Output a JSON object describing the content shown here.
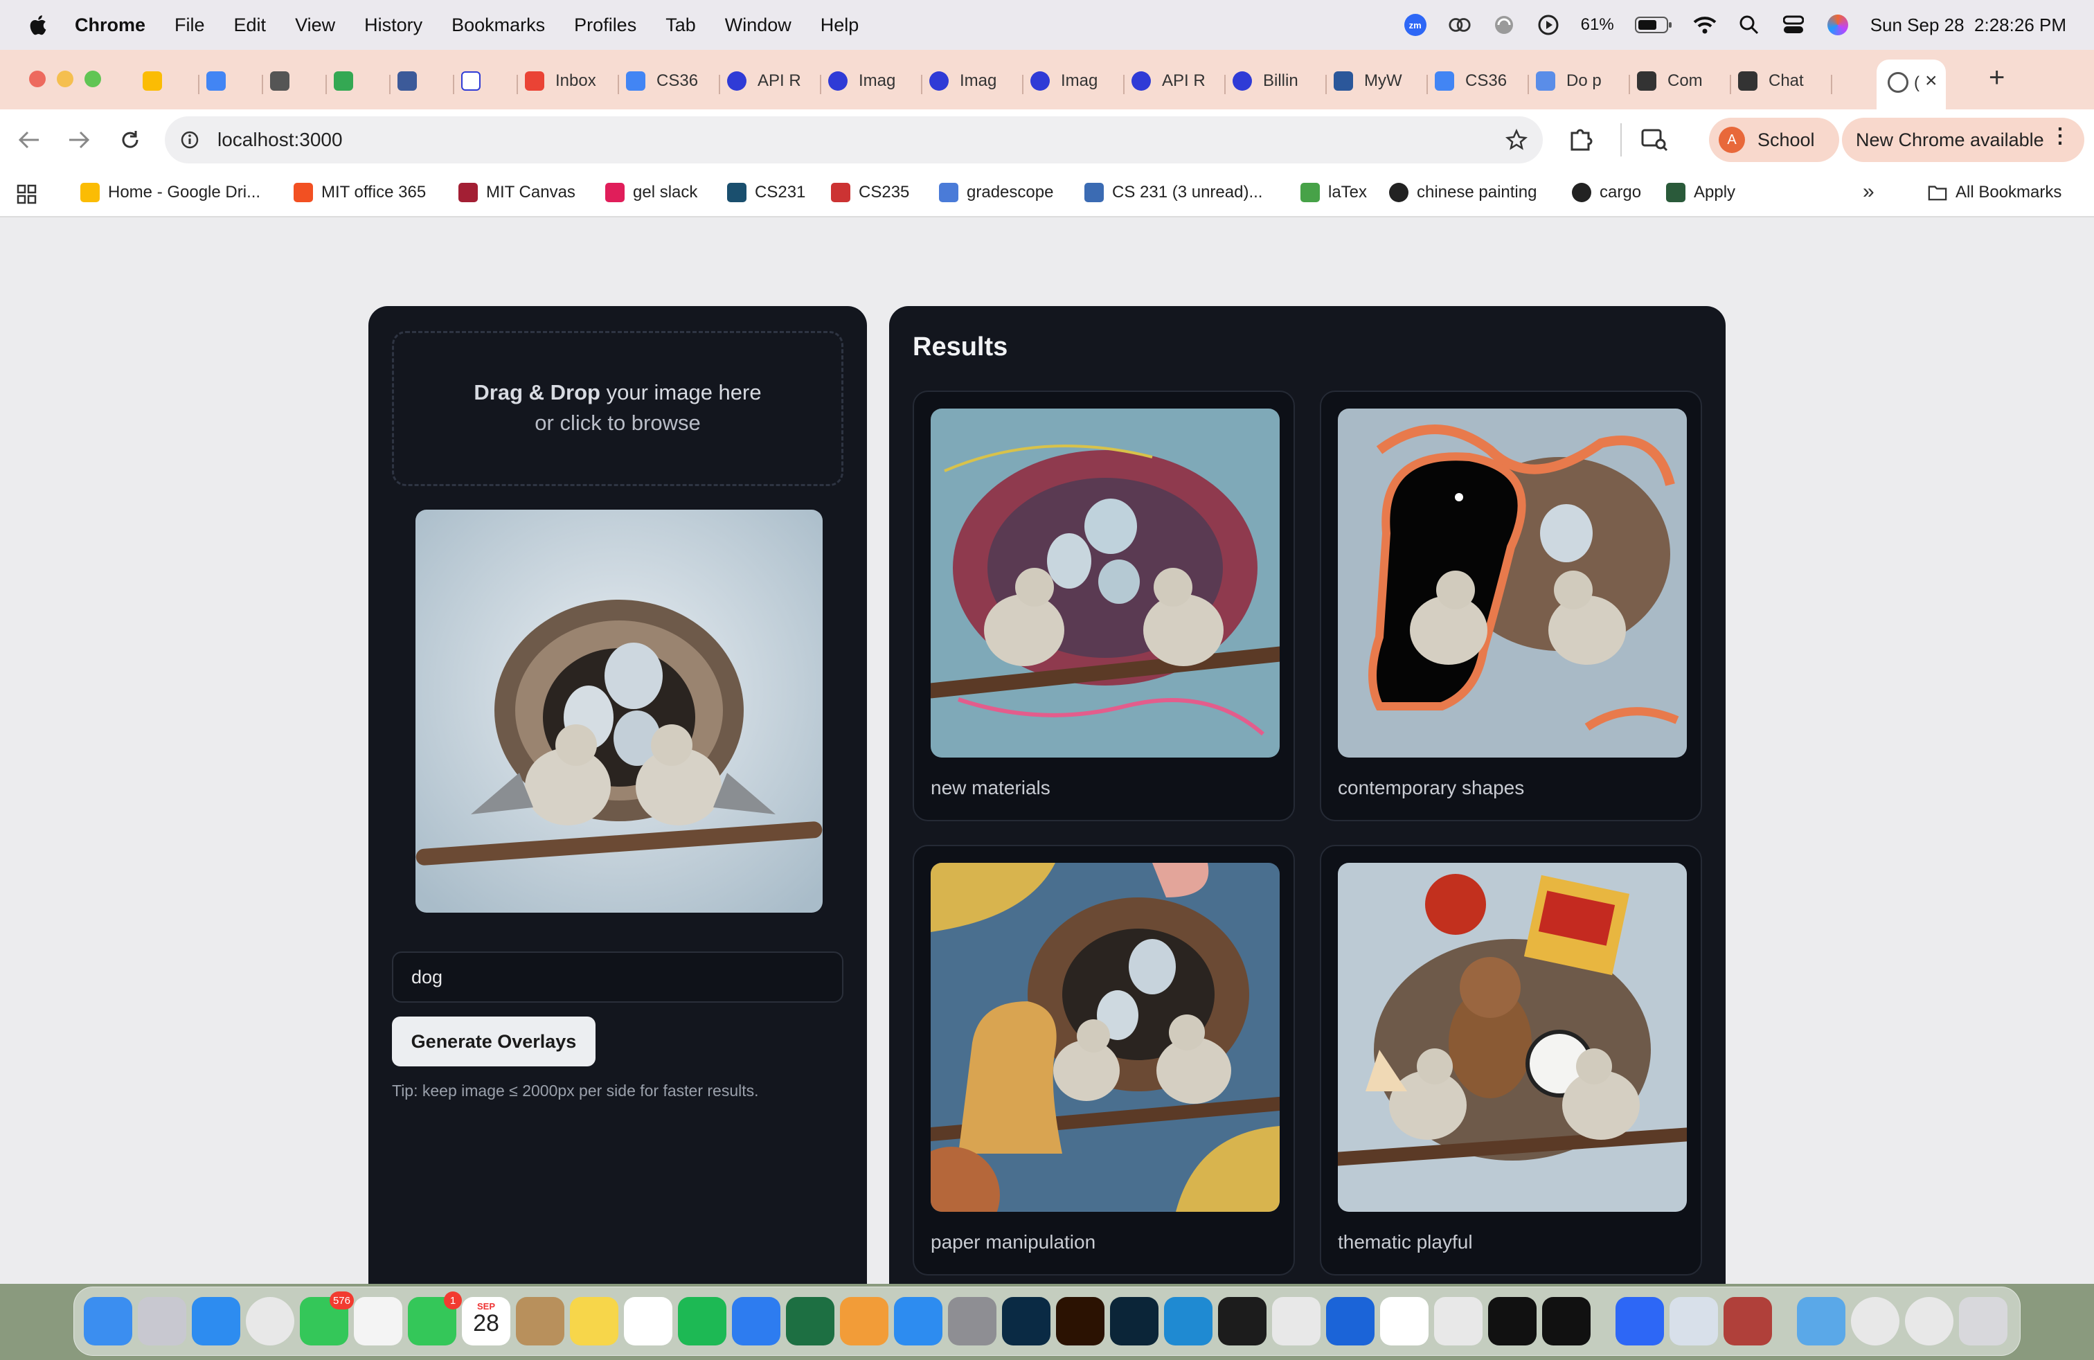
{
  "menubar": {
    "app": "Chrome",
    "items": [
      "File",
      "Edit",
      "View",
      "History",
      "Bookmarks",
      "Profiles",
      "Tab",
      "Window",
      "Help"
    ],
    "status": {
      "zoom": "zm",
      "battery": "61%",
      "datetime": "Sun Sep 28  2:28:26 PM"
    }
  },
  "tabs": [
    {
      "label": "",
      "icon": "google-drive-icon"
    },
    {
      "label": "",
      "icon": "google-calendar-icon"
    },
    {
      "label": "",
      "icon": "squiggle-icon"
    },
    {
      "label": "",
      "icon": "google-sheets-icon"
    },
    {
      "label": "",
      "icon": "calendar-grid-icon"
    },
    {
      "label": "",
      "icon": "wikipedia-icon"
    },
    {
      "label": "Inbox",
      "icon": "gmail-icon"
    },
    {
      "label": "CS36",
      "icon": "google-docs-icon"
    },
    {
      "label": "API R",
      "icon": "openai-icon"
    },
    {
      "label": "Imag",
      "icon": "openai-icon"
    },
    {
      "label": "Imag",
      "icon": "openai-icon"
    },
    {
      "label": "Imag",
      "icon": "openai-icon"
    },
    {
      "label": "API R",
      "icon": "openai-icon"
    },
    {
      "label": "Billin",
      "icon": "openai-icon"
    },
    {
      "label": "MyW",
      "icon": "word-icon"
    },
    {
      "label": "CS36",
      "icon": "google-docs-icon"
    },
    {
      "label": "Do p",
      "icon": "gemini-icon"
    },
    {
      "label": "Com",
      "icon": "chatgpt-icon"
    },
    {
      "label": "Chat",
      "icon": "chatgpt-icon"
    },
    {
      "label": "(",
      "icon": "globe-icon"
    }
  ],
  "toolbar": {
    "url": "localhost:3000",
    "profile_initial": "A",
    "profile_label": "School",
    "update_label": "New Chrome available"
  },
  "bookmarks": [
    {
      "label": "Home - Google Dri...",
      "icon": "google-drive-icon"
    },
    {
      "label": "MIT office 365",
      "icon": "microsoft-icon"
    },
    {
      "label": "MIT Canvas",
      "icon": "mit-icon"
    },
    {
      "label": "gel slack",
      "icon": "slack-icon"
    },
    {
      "label": "CS231",
      "icon": "cs231-icon"
    },
    {
      "label": "CS235",
      "icon": "cs235-icon"
    },
    {
      "label": "gradescope",
      "icon": "gradescope-icon"
    },
    {
      "label": "CS 231 (3 unread)...",
      "icon": "piazza-icon"
    },
    {
      "label": "laTex",
      "icon": "overleaf-icon"
    },
    {
      "label": "chinese painting",
      "icon": "globe-icon"
    },
    {
      "label": "cargo",
      "icon": "globe-icon"
    },
    {
      "label": "Apply",
      "icon": "apply-icon"
    }
  ],
  "bookmarks_all": "All Bookmarks",
  "app": {
    "dropzone": {
      "bold": "Drag & Drop",
      "line1_rest": " your image here",
      "line2": "or click to browse"
    },
    "prompt_value": "dog",
    "generate_label": "Generate Overlays",
    "tip": "Tip: keep image ≤ 2000px per side for faster results.",
    "results_title": "Results",
    "results": [
      {
        "caption": "new materials"
      },
      {
        "caption": "contemporary shapes"
      },
      {
        "caption": "paper manipulation"
      },
      {
        "caption": "thematic playful"
      }
    ]
  },
  "dock": {
    "messages_badge": "576",
    "facetime_badge": "1",
    "calendar_month": "SEP",
    "calendar_day": "28"
  },
  "colors": {
    "panel": "#13161e",
    "page_bg": "#ececee",
    "tabstrip": "#f7dcd2",
    "accent_pill": "#f8d8cc",
    "profile": "#e8683a"
  }
}
